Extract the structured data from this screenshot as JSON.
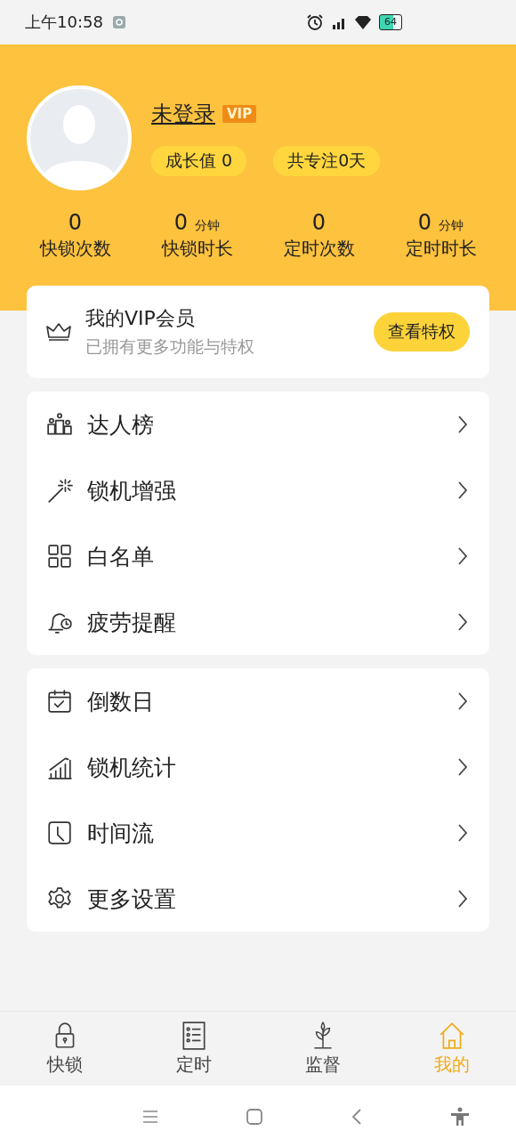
{
  "status_bar": {
    "time": "上午10:58",
    "battery": "64"
  },
  "profile": {
    "name": "未登录",
    "badge": "VIP",
    "chips": [
      "成长值 0",
      "共专注0天"
    ]
  },
  "stats": [
    {
      "value": "0",
      "label": "快锁次数"
    },
    {
      "value": "0",
      "unit": "分钟",
      "label": "快锁时长"
    },
    {
      "value": "0",
      "label": "定时次数"
    },
    {
      "value": "0",
      "unit": "分钟",
      "label": "定时时长"
    }
  ],
  "vip_card": {
    "title": "我的VIP会员",
    "subtitle": "已拥有更多功能与特权",
    "button": "查看特权"
  },
  "menu_groups": [
    [
      {
        "label": "达人榜"
      },
      {
        "label": "锁机增强"
      },
      {
        "label": "白名单"
      },
      {
        "label": "疲劳提醒"
      }
    ],
    [
      {
        "label": "倒数日"
      },
      {
        "label": "锁机统计"
      },
      {
        "label": "时间流"
      },
      {
        "label": "更多设置"
      }
    ]
  ],
  "tabs": [
    {
      "label": "快锁",
      "selected": false
    },
    {
      "label": "定时",
      "selected": false
    },
    {
      "label": "监督",
      "selected": false
    },
    {
      "label": "我的",
      "selected": true
    }
  ]
}
